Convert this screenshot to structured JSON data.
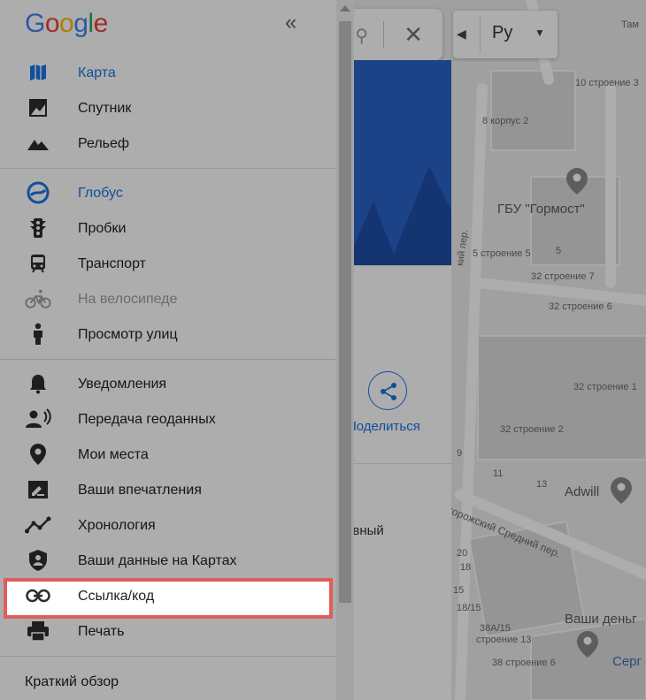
{
  "menu": {
    "logo": "Google",
    "collapse_icon": "double-chevron-left-icon",
    "groups": [
      [
        {
          "label": "Карта",
          "icon": "map-icon",
          "active": true
        },
        {
          "label": "Спутник",
          "icon": "satellite-icon"
        },
        {
          "label": "Рельеф",
          "icon": "terrain-icon"
        }
      ],
      [
        {
          "label": "Глобус",
          "icon": "globe-icon",
          "active": true
        },
        {
          "label": "Пробки",
          "icon": "traffic-icon"
        },
        {
          "label": "Транспорт",
          "icon": "transit-icon"
        },
        {
          "label": "На велосипеде",
          "icon": "bike-icon",
          "disabled": true
        },
        {
          "label": "Просмотр улиц",
          "icon": "pegman-icon"
        }
      ],
      [
        {
          "label": "Уведомления",
          "icon": "bell-icon"
        },
        {
          "label": "Передача геоданных",
          "icon": "location-sharing-icon"
        },
        {
          "label": "Мои места",
          "icon": "place-pin-icon"
        },
        {
          "label": "Ваши впечатления",
          "icon": "review-icon"
        },
        {
          "label": "Хронология",
          "icon": "timeline-icon"
        },
        {
          "label": "Ваши данные на Картах",
          "icon": "shield-person-icon"
        },
        {
          "label": "Ссылка/код",
          "icon": "link-icon",
          "highlighted": true
        },
        {
          "label": "Печать",
          "icon": "print-icon"
        }
      ]
    ],
    "overview": "Краткий обзор"
  },
  "place_panel": {
    "share_label": "Поделиться",
    "mode_text": "ивный"
  },
  "map_controls": {
    "language": "Ру"
  },
  "map_labels": {
    "tamb": "Там",
    "b10_3": "10 строение 3",
    "k2": "8 корпус 2",
    "gbu": "ГБУ \"Гормост\"",
    "lane1": "кий пер.",
    "b5_5": "5 строение 5",
    "n5": "5",
    "b32_7": "32 строение 7",
    "b32_6": "32 строение 6",
    "b32_1": "32 строение 1",
    "b32_2": "32 строение 2",
    "n9": "9",
    "n11": "11",
    "n13": "13",
    "adwill": "Adwill",
    "street2": "горожский Средний пер.",
    "n20": "20",
    "n18": "18",
    "n15": "15",
    "b18_15": "18/15",
    "n38a": "38А/15",
    "b13": "строение 13",
    "b38_6": "38 строение 6",
    "money": "Ваши деньг",
    "serg": "Серг"
  },
  "colors": {
    "accent": "#1a73e8",
    "highlight_border": "#e05d5d",
    "hero_blue": "#2a63c7"
  }
}
